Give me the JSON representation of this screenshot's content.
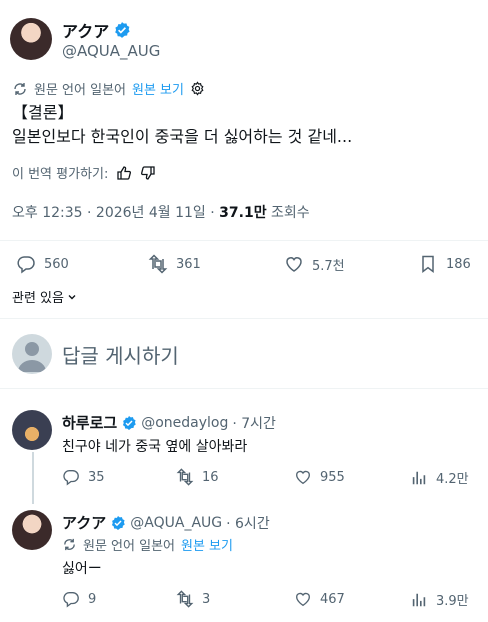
{
  "tweet": {
    "author_name": "アクア",
    "author_handle": "@AQUA_AUG",
    "translation_note": "원문 언어 일본어",
    "show_original": "원본 보기",
    "line1": "【결론】",
    "line2": "일본인보다 한국인이 중국을 더 싫어하는 것 같네...",
    "rate_translation": "이 번역 평가하기:",
    "timestamp": "오후 12:35 · 2026년 4월 11일 · ",
    "views_value": "37.1만",
    "views_label": " 조회수",
    "replies": "560",
    "retweets": "361",
    "likes": "5.7천",
    "bookmarks": "186",
    "related": "관련 있음"
  },
  "reply_box": {
    "placeholder": "답글 게시하기"
  },
  "replies": [
    {
      "name": "하루로그",
      "handle": "@onedaylog",
      "time": " · 7시간",
      "text": "친구야 네가 중국 옆에 살아봐라",
      "replies": "35",
      "retweets": "16",
      "likes": "955",
      "views": "4.2만"
    },
    {
      "name": "アクア",
      "handle": "@AQUA_AUG",
      "time": " · 6시간",
      "translation_note": "원문 언어 일본어",
      "show_original": "원본 보기",
      "text": "싫어ー",
      "replies": "9",
      "retweets": "3",
      "likes": "467",
      "views": "3.9만"
    }
  ],
  "colors": {
    "accent": "#1d9bf0",
    "text": "#0f1419",
    "muted": "#536471",
    "divider": "#eff3f4"
  }
}
